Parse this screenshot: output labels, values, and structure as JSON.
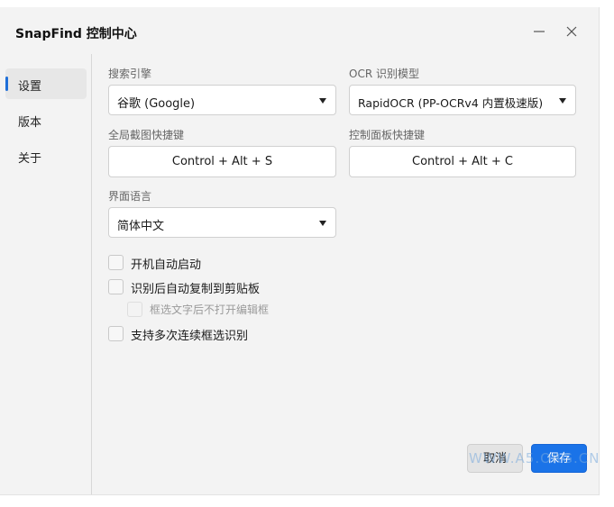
{
  "window": {
    "title": "SnapFind 控制中心",
    "minimize_icon": "minimize-icon",
    "close_icon": "close-icon"
  },
  "sidebar": {
    "items": [
      {
        "label": "设置",
        "active": true
      },
      {
        "label": "版本",
        "active": false
      },
      {
        "label": "关于",
        "active": false
      }
    ]
  },
  "settings": {
    "search_engine": {
      "label": "搜索引擎",
      "value": "谷歌 (Google)"
    },
    "ocr_model": {
      "label": "OCR 识别模型",
      "value": "RapidOCR (PP-OCRv4 内置极速版)"
    },
    "global_hotkey": {
      "label": "全局截图快捷键",
      "value": "Control + Alt + S"
    },
    "panel_hotkey": {
      "label": "控制面板快捷键",
      "value": "Control + Alt + C"
    },
    "language": {
      "label": "界面语言",
      "value": "简体中文"
    },
    "checkboxes": [
      {
        "label": "开机自动启动",
        "checked": false,
        "enabled": true
      },
      {
        "label": "识别后自动复制到剪贴板",
        "checked": false,
        "enabled": true
      },
      {
        "label": "框选文字后不打开编辑框",
        "checked": false,
        "enabled": false
      },
      {
        "label": "支持多次连续框选识别",
        "checked": false,
        "enabled": true
      }
    ]
  },
  "footer": {
    "cancel_label": "取消",
    "save_label": "保存"
  },
  "watermark": "WWW.A5.ORG.CN",
  "colors": {
    "accent": "#1a73e8",
    "window_bg": "#f3f3f3"
  }
}
